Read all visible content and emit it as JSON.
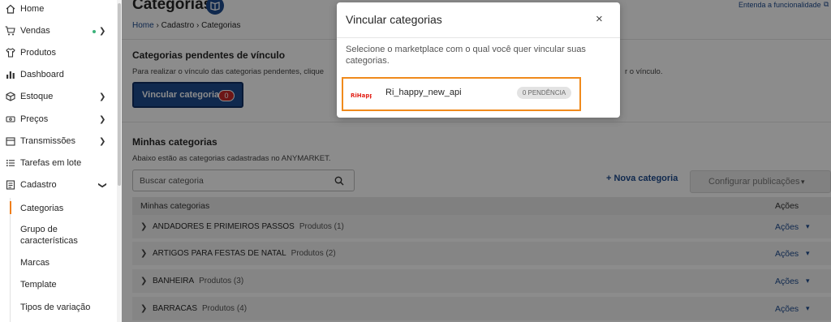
{
  "sidebar": {
    "items": [
      {
        "label": "Home",
        "icon": "home-icon"
      },
      {
        "label": "Vendas",
        "icon": "cart-icon"
      },
      {
        "label": "Produtos",
        "icon": "shirt-icon"
      },
      {
        "label": "Dashboard",
        "icon": "bar-chart-icon"
      },
      {
        "label": "Estoque",
        "icon": "box-icon"
      },
      {
        "label": "Preços",
        "icon": "price-tag-icon"
      },
      {
        "label": "Transmissões",
        "icon": "calendar-icon"
      },
      {
        "label": "Tarefas em lote",
        "icon": "list-icon"
      },
      {
        "label": "Cadastro",
        "icon": "form-icon"
      }
    ],
    "sub_items": [
      "Categorias",
      "Grupo de características",
      "Marcas",
      "Template",
      "Tipos de variação"
    ],
    "active_sub_item": "Categorias"
  },
  "header": {
    "title": "Categorias",
    "help_link": "Entenda a funcionalidade",
    "breadcrumb": {
      "home": "Home",
      "sep": "›",
      "cadastro": "Cadastro",
      "current": "Categorias"
    }
  },
  "pending": {
    "title": "Categorias pendentes de vínculo",
    "desc": "Para realizar o vínculo das categorias pendentes, clique",
    "desc_tail": "r o vínculo.",
    "button_label": "Vincular categorias",
    "badge": "0"
  },
  "mine": {
    "title": "Minhas categorias",
    "desc": "Abaixo estão as categorias cadastradas no ANYMARKET.",
    "search_placeholder": "Buscar categoria",
    "new_button": "+ Nova categoria",
    "config_button": "Configurar publicações",
    "columns": [
      "Minhas categorias",
      "Ações"
    ],
    "rows": [
      {
        "name": "ANDADORES E PRIMEIROS PASSOS",
        "count": "Produtos (1)",
        "action": "Ações"
      },
      {
        "name": "ARTIGOS PARA FESTAS DE NATAL",
        "count": "Produtos (2)",
        "action": "Ações"
      },
      {
        "name": "BANHEIRA",
        "count": "Produtos (3)",
        "action": "Ações"
      },
      {
        "name": "BARRACAS",
        "count": "Produtos (4)",
        "action": "Ações"
      }
    ]
  },
  "modal": {
    "title": "Vincular categorias",
    "close": "×",
    "desc": "Selecione o marketplace com o qual você quer vincular suas categorias.",
    "marketplace": {
      "logo_text": "RiHappy",
      "name": "Ri_happy_new_api",
      "badge": "0 PENDÊNCIA"
    }
  },
  "colors": {
    "primary": "#1e4b8f",
    "accent": "#f08a1c",
    "badge": "#c62828",
    "status_dot": "#3bb27a"
  }
}
